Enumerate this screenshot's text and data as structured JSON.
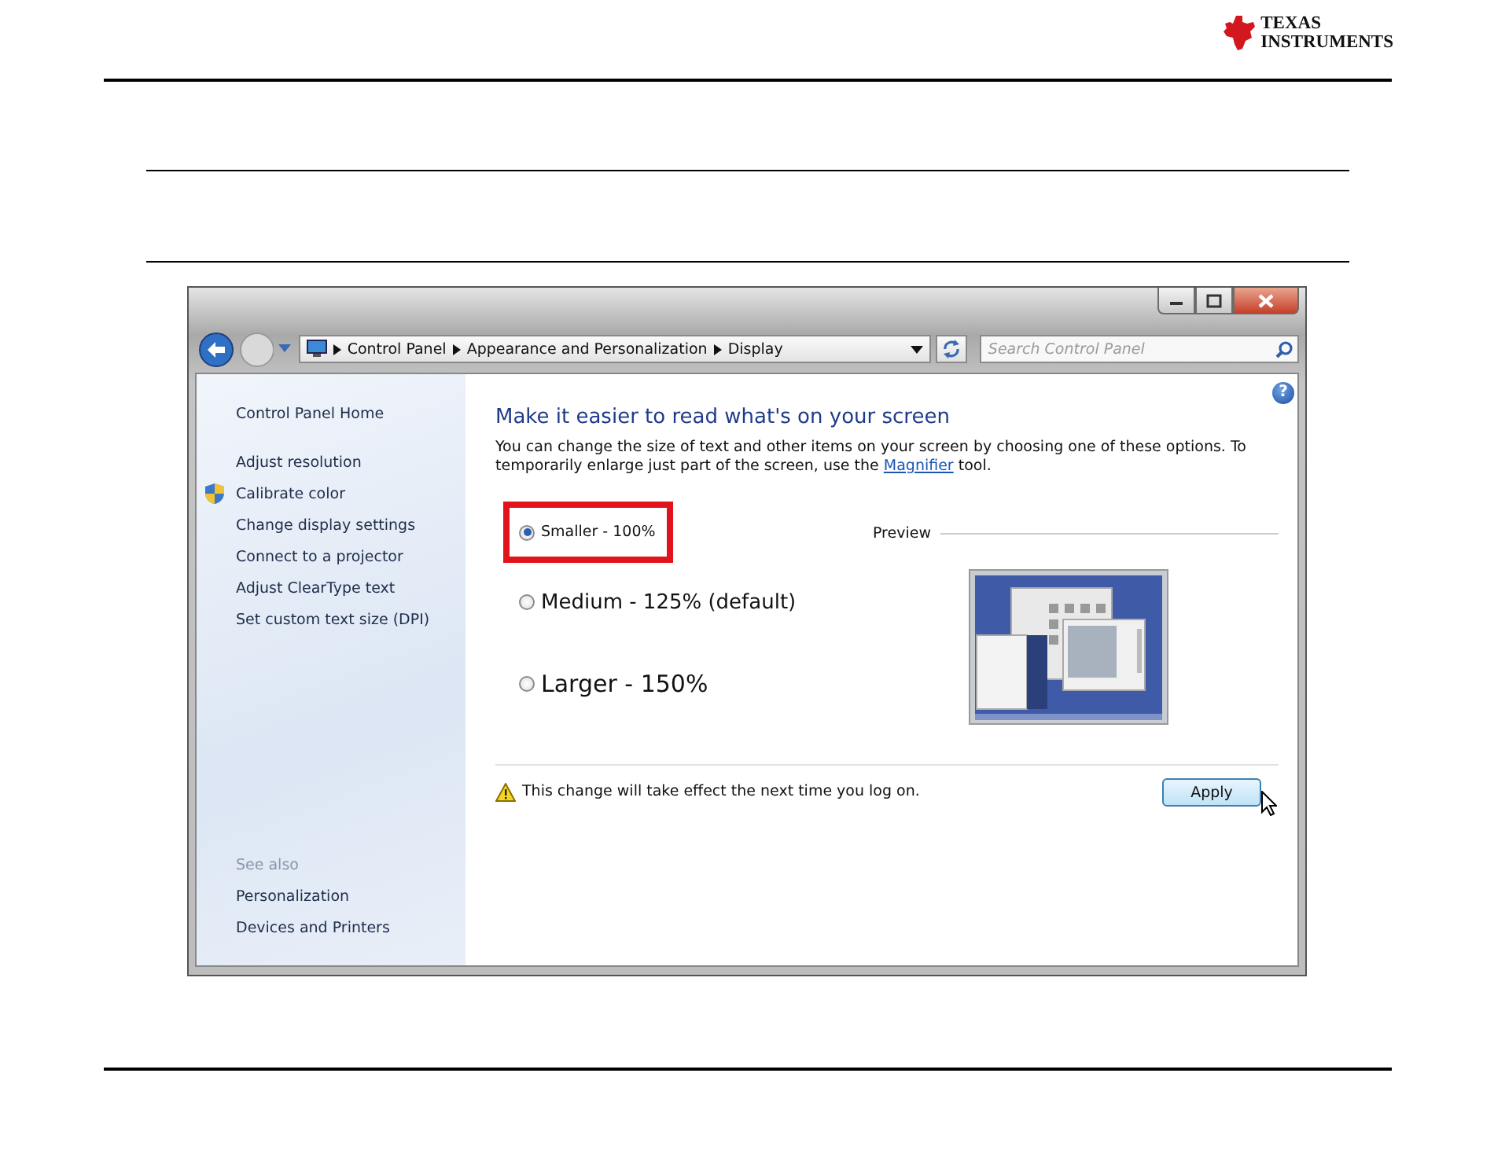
{
  "header": {
    "logo": [
      "TEXAS",
      "INSTRUMENTS"
    ]
  },
  "window": {
    "address": {
      "path": [
        "Control Panel",
        "Appearance and Personalization",
        "Display"
      ]
    },
    "search": {
      "placeholder": "Search Control Panel"
    },
    "sidebar": {
      "home": "Control Panel Home",
      "tasks": [
        {
          "label": "Adjust resolution",
          "kind": "plain"
        },
        {
          "label": "Calibrate color",
          "kind": "shield"
        },
        {
          "label": "Change display settings",
          "kind": "plain"
        },
        {
          "label": "Connect to a projector",
          "kind": "plain"
        },
        {
          "label": "Adjust ClearType text",
          "kind": "plain"
        },
        {
          "label": "Set custom text size (DPI)",
          "kind": "plain"
        }
      ],
      "see_also": {
        "heading": "See also",
        "links": [
          "Personalization",
          "Devices and Printers"
        ]
      }
    },
    "main": {
      "help": "?",
      "heading": "Make it easier to read what's on your screen",
      "description": {
        "before": "You can change the size of text and other items on your screen by choosing one of these options. To temporarily enlarge just part of the screen, use the ",
        "link": "Magnifier",
        "after": " tool."
      },
      "options": [
        {
          "label": "Smaller - 100%",
          "kind": "small",
          "selected": true,
          "highlighted": true
        },
        {
          "label": "Medium - 125% (default)",
          "kind": "medium",
          "selected": false,
          "highlighted": false
        },
        {
          "label": "Larger - 150%",
          "kind": "large",
          "selected": false,
          "highlighted": false
        }
      ],
      "preview": {
        "label": "Preview"
      },
      "notice": "This change will take effect the next time you log on.",
      "apply": "Apply"
    }
  }
}
